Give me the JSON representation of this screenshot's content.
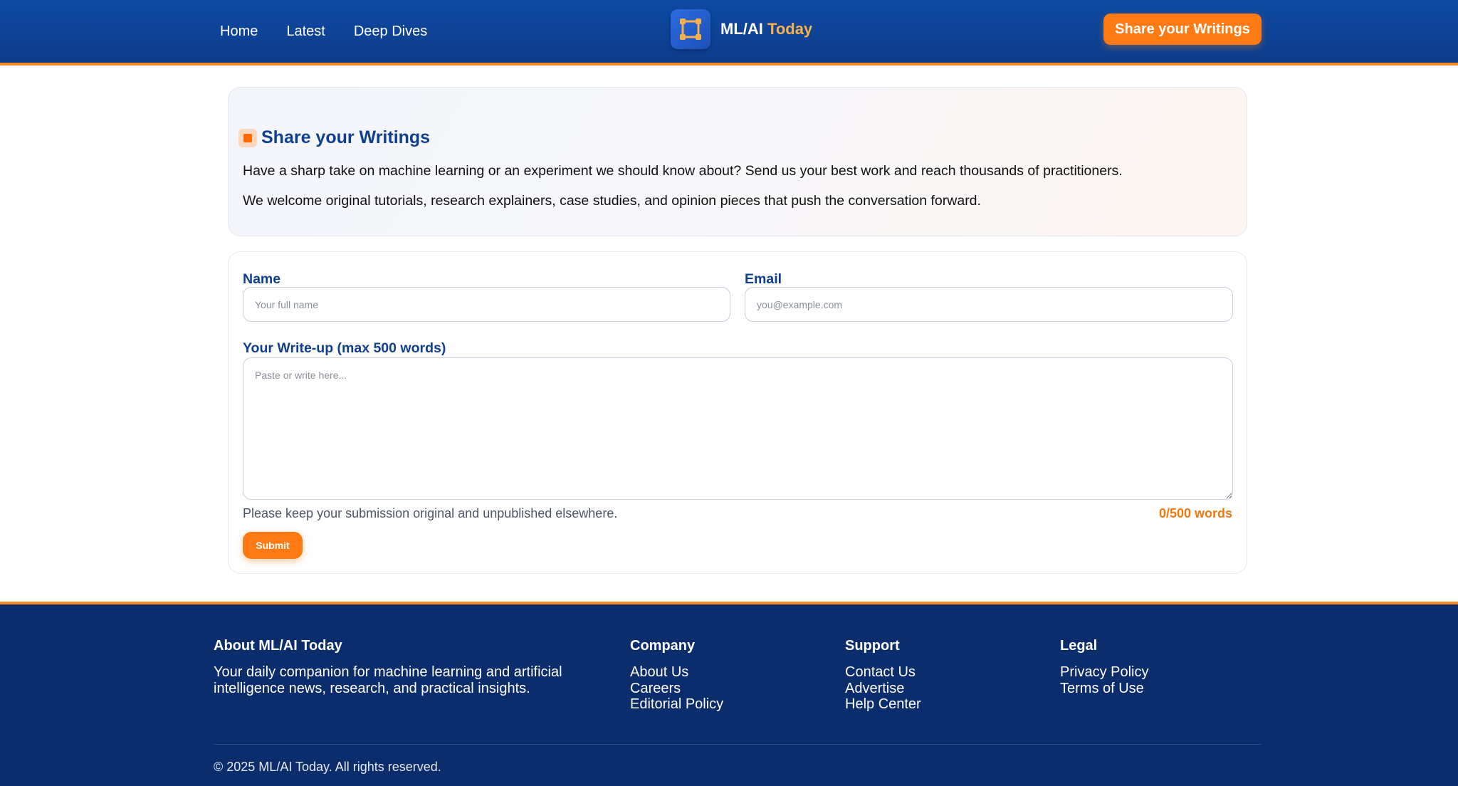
{
  "header": {
    "nav": [
      "Home",
      "Latest",
      "Deep Dives"
    ],
    "brand": {
      "name": "ML/AI",
      "accent": "Today"
    },
    "cta_label": "Share your Writings"
  },
  "intro": {
    "title": "Share your Writings",
    "paragraph1": "Have a sharp take on machine learning or an experiment we should know about? Send us your best work and reach thousands of practitioners.",
    "paragraph2": "We welcome original tutorials, research explainers, case studies, and opinion pieces that push the conversation forward."
  },
  "form": {
    "name_label": "Name",
    "name_placeholder": "Your full name",
    "email_label": "Email",
    "email_placeholder": "you@example.com",
    "writeup_label": "Your Write-up (max 500 words)",
    "writeup_placeholder": "Paste or write here...",
    "hint": "Please keep your submission original and unpublished elsewhere.",
    "word_count": "0/500 words",
    "submit_label": "Submit"
  },
  "footer": {
    "about": {
      "title": "About ML/AI Today",
      "text": "Your daily companion for machine learning and artificial intelligence news, research, and practical insights."
    },
    "columns": [
      {
        "title": "Company",
        "links": [
          "About Us",
          "Careers",
          "Editorial Policy"
        ]
      },
      {
        "title": "Support",
        "links": [
          "Contact Us",
          "Advertise",
          "Help Center"
        ]
      },
      {
        "title": "Legal",
        "links": [
          "Privacy Policy",
          "Terms of Use"
        ]
      }
    ],
    "copyright": "© 2025 ML/AI Today. All rights reserved."
  },
  "colors": {
    "header_bg": "#0f4aa3",
    "accent_orange": "#ff7a12",
    "heading_blue": "#0f3f8f",
    "footer_bg": "#0c2d6b"
  },
  "icons": {
    "brand_logo": "vector-square-icon",
    "title_marker": "square-bullet-icon"
  }
}
